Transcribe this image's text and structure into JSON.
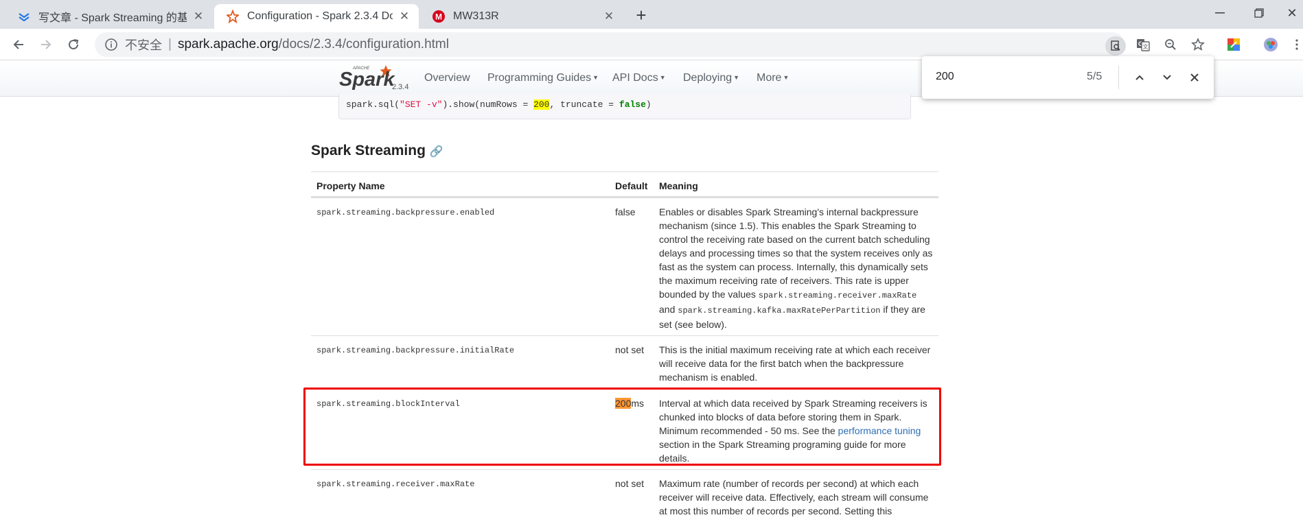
{
  "browser": {
    "tabs": [
      {
        "title": "写文章 - Spark Streaming 的基",
        "favicon": "zhihu-write-icon"
      },
      {
        "title": "Configuration - Spark 2.3.4 Do",
        "favicon": "spark-star-icon"
      },
      {
        "title": "MW313R",
        "favicon": "mercury-router-icon"
      }
    ],
    "url_security": "不安全",
    "url_host": "spark.apache.org",
    "url_path": "/docs/2.3.4/configuration.html"
  },
  "find_bar": {
    "query": "200",
    "count": "5/5"
  },
  "site_nav": {
    "version": "2.3.4",
    "logo_apache": "APACHE",
    "logo_spark": "Spark",
    "items": [
      "Overview",
      "Programming Guides",
      "API Docs",
      "Deploying",
      "More"
    ]
  },
  "code_snippet": {
    "before": "spark.sql(",
    "string": "\"SET -v\"",
    "middle": ").show(numRows = ",
    "highlight": "200",
    "after_comma": ", truncate = ",
    "keyword": "false",
    "end": ")"
  },
  "section": {
    "title": "Spark Streaming"
  },
  "table": {
    "headers": [
      "Property Name",
      "Default",
      "Meaning"
    ],
    "rows": [
      {
        "name": "spark.streaming.backpressure.enabled",
        "default": "false",
        "meaning_1": "Enables or disables Spark Streaming's internal backpressure mechanism (since 1.5). This enables the Spark Streaming to control the receiving rate based on the current batch scheduling delays and processing times so that the system receives only as fast as the system can process. Internally, this dynamically sets the maximum receiving rate of receivers. This rate is upper bounded by the values ",
        "code_1": "spark.streaming.receiver.maxRate",
        "meaning_2": " and ",
        "code_2": "spark.streaming.kafka.maxRatePerPartition",
        "meaning_3": " if they are set (see below)."
      },
      {
        "name": "spark.streaming.backpressure.initialRate",
        "default": "not set",
        "meaning": "This is the initial maximum receiving rate at which each receiver will receive data for the first batch when the backpressure mechanism is enabled."
      },
      {
        "name": "spark.streaming.blockInterval",
        "default_hl": "200",
        "default_rest": "ms",
        "meaning_1": "Interval at which data received by Spark Streaming receivers is chunked into blocks of data before storing them in Spark. Minimum recommended - 50 ms. See the ",
        "link": "performance tuning",
        "meaning_2": " section in the Spark Streaming programing guide for more details."
      },
      {
        "name": "spark.streaming.receiver.maxRate",
        "default": "not set",
        "meaning": "Maximum rate (number of records per second) at which each receiver will receive data. Effectively, each stream will consume at most this number of records per second. Setting this"
      }
    ]
  },
  "colors": {
    "find_highlight": "#ffff00",
    "find_current": "#ff9632",
    "annotation_box": "#ee0000",
    "link": "#2e6fb5"
  }
}
